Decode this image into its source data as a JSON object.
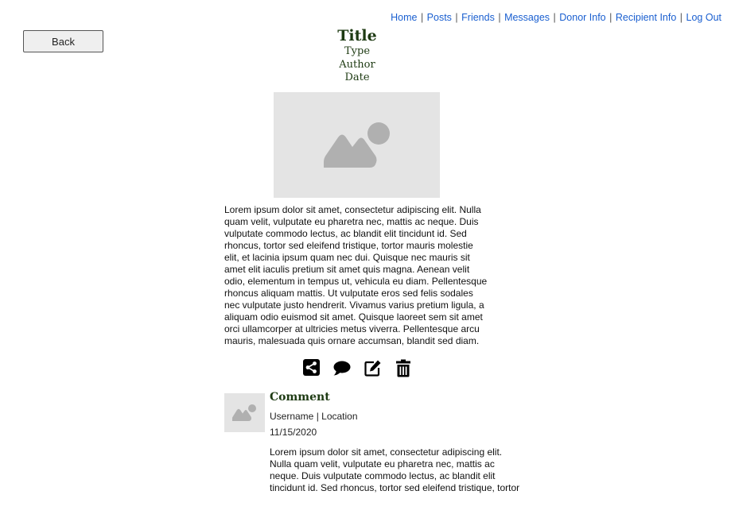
{
  "nav": {
    "items": [
      "Home",
      "Posts",
      "Friends",
      "Messages",
      "Donor Info",
      "Recipient Info",
      "Log Out"
    ],
    "separator": "|"
  },
  "back_button": {
    "label": "Back"
  },
  "post": {
    "title": "Title",
    "type": "Type",
    "author": "Author",
    "date": "Date",
    "image_icon": "image-placeholder-icon",
    "body": "Lorem ipsum dolor sit amet, consectetur adipiscing elit. Nulla quam velit, vulputate eu pharetra nec, mattis ac neque. Duis vulputate commodo lectus, ac blandit elit tincidunt id. Sed rhoncus, tortor sed eleifend tristique, tortor mauris molestie elit, et lacinia ipsum quam nec dui. Quisque nec mauris sit amet elit iaculis pretium sit amet quis magna. Aenean velit odio, elementum in tempus ut, vehicula eu diam. Pellentesque rhoncus aliquam mattis. Ut vulputate eros sed felis sodales nec vulputate justo hendrerit. Vivamus varius pretium ligula, a aliquam odio euismod sit amet. Quisque laoreet sem sit amet orci ullamcorper at ultricies metus viverra. Pellentesque arcu mauris, malesuada quis ornare accumsan, blandit sed diam."
  },
  "actions": [
    {
      "name": "share",
      "icon": "share-icon"
    },
    {
      "name": "comment",
      "icon": "comment-icon"
    },
    {
      "name": "edit",
      "icon": "edit-icon"
    },
    {
      "name": "delete",
      "icon": "trash-icon"
    }
  ],
  "comment": {
    "title": "Comment",
    "user_location": "Username | Location",
    "date": "11/15/2020",
    "avatar_icon": "image-placeholder-icon",
    "body": "Lorem ipsum dolor sit amet, consectetur adipiscing elit. Nulla quam velit, vulputate eu pharetra nec, mattis ac neque. Duis vulputate commodo lectus, ac blandit elit tincidunt id. Sed rhoncus, tortor sed eleifend tristique, tortor mauris molestie elit, et lacinia ipsum quam nec dui."
  },
  "colors": {
    "link": "#1a5fd0",
    "heading": "#1d3a12",
    "placeholder_bg": "#e4e4e4",
    "placeholder_fg": "#b0b0b0"
  }
}
